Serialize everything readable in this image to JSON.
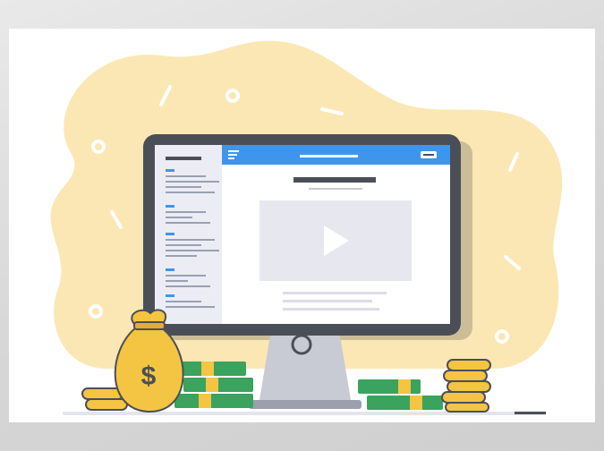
{
  "illustration": {
    "subject": "",
    "colors": {
      "blob": "#fbe7b3",
      "monitor_frame": "#4a4f57",
      "header_bar": "#3d96ec",
      "screen_bg": "#ffffff",
      "sidebar_bg": "#ecedf4",
      "sidebar_link": "#3d96ec",
      "sidebar_text": "#9aa0b3",
      "video_box": "#e7e8ef",
      "money_green": "#3aa35e",
      "coin_gold": "#f4c542",
      "bag_gold": "#f4c542",
      "stand": "#c8cad4"
    },
    "icons": [
      "menu-icon",
      "play-icon",
      "dollar-icon",
      "money-bag-icon",
      "coin-stack-icon",
      "banknote-stack-icon"
    ],
    "bag_symbol": "$"
  }
}
